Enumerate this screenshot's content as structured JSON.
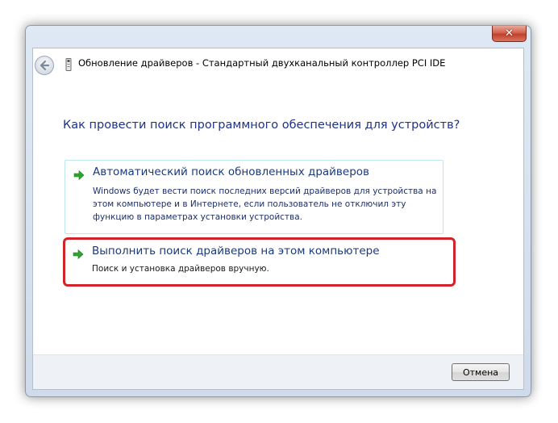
{
  "window": {
    "title": "Обновление драйверов - Стандартный двухканальный контроллер PCI IDE",
    "close_glyph": "✕"
  },
  "question": "Как провести поиск программного обеспечения для устройств?",
  "options": [
    {
      "title": "Автоматический поиск обновленных драйверов",
      "description": "Windows будет вести поиск последних версий драйверов для устройства на этом компьютере и в Интернете, если пользователь не отключил эту функцию в параметрах установки устройства."
    },
    {
      "title": "Выполнить поиск драйверов на этом компьютере",
      "description": "Поиск и установка драйверов вручную."
    }
  ],
  "footer": {
    "cancel_label": "Отмена"
  },
  "icons": {
    "back": "back-arrow-icon",
    "device": "device-icon",
    "option_arrow": "green-arrow-icon",
    "close": "close-icon"
  },
  "colors": {
    "heading": "#1e3287",
    "option_link": "#1c3a7a",
    "arrow_green": "#2fa52f",
    "highlight": "#d2232a",
    "close_button": "#c2402a"
  }
}
